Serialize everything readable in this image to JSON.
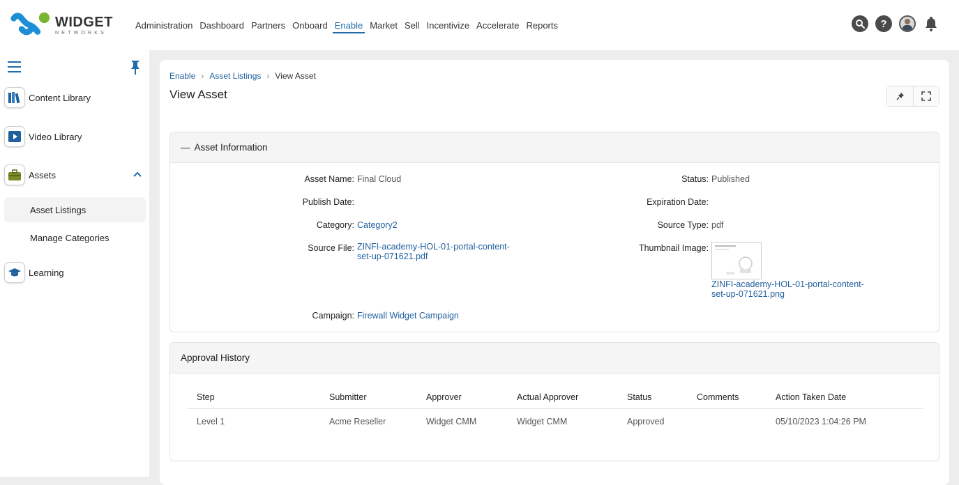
{
  "header": {
    "logo_text": "WIDGET",
    "logo_sub": "NETWORKS",
    "nav": [
      "Administration",
      "Dashboard",
      "Partners",
      "Onboard",
      "Enable",
      "Market",
      "Sell",
      "Incentivize",
      "Accelerate",
      "Reports"
    ],
    "active_nav": "Enable",
    "icons": [
      "search-icon",
      "help-icon",
      "user-avatar",
      "bell-icon"
    ]
  },
  "sidebar": {
    "items": [
      {
        "label": "Content Library",
        "icon": "books-icon"
      },
      {
        "label": "Video Library",
        "icon": "video-icon"
      },
      {
        "label": "Assets",
        "icon": "briefcase-icon"
      },
      {
        "label": "Learning",
        "icon": "graduation-cap-icon"
      }
    ],
    "sub_items": [
      "Asset Listings",
      "Manage Categories"
    ],
    "active_sub": "Asset Listings"
  },
  "breadcrumb": {
    "items": [
      "Enable",
      "Asset Listings",
      "View Asset"
    ]
  },
  "page": {
    "title": "View Asset"
  },
  "asset_info": {
    "heading": "Asset Information",
    "asset_name_label": "Asset Name:",
    "asset_name": "Final Cloud",
    "publish_date_label": "Publish Date:",
    "publish_date": "",
    "category_label": "Category:",
    "category": "Category2",
    "source_file_label": "Source File:",
    "source_file_1": "ZINFI-academy-HOL-01-portal-content-",
    "source_file_2": "set-up-071621.pdf",
    "campaign_label": "Campaign:",
    "campaign": "Firewall Widget Campaign",
    "status_label": "Status:",
    "status": "Published",
    "expiration_date_label": "Expiration Date:",
    "expiration_date": "",
    "source_type_label": "Source Type:",
    "source_type": "pdf",
    "thumbnail_label": "Thumbnail Image:",
    "thumbnail_file_1": "ZINFI-academy-HOL-01-portal-content-",
    "thumbnail_file_2": "set-up-071621.png"
  },
  "approval_history": {
    "heading": "Approval History",
    "columns": [
      "Step",
      "Submitter",
      "Approver",
      "Actual Approver",
      "Status",
      "Comments",
      "Action Taken Date"
    ],
    "rows": [
      [
        "Level 1",
        "Acme Reseller",
        "Widget CMM",
        "Widget CMM",
        "Approved",
        "",
        "05/10/2023 1:04:26 PM"
      ]
    ]
  },
  "colors": {
    "accent": "#1f6bab",
    "logo_blue": "#1e8fd6",
    "logo_green": "#7ab534"
  }
}
